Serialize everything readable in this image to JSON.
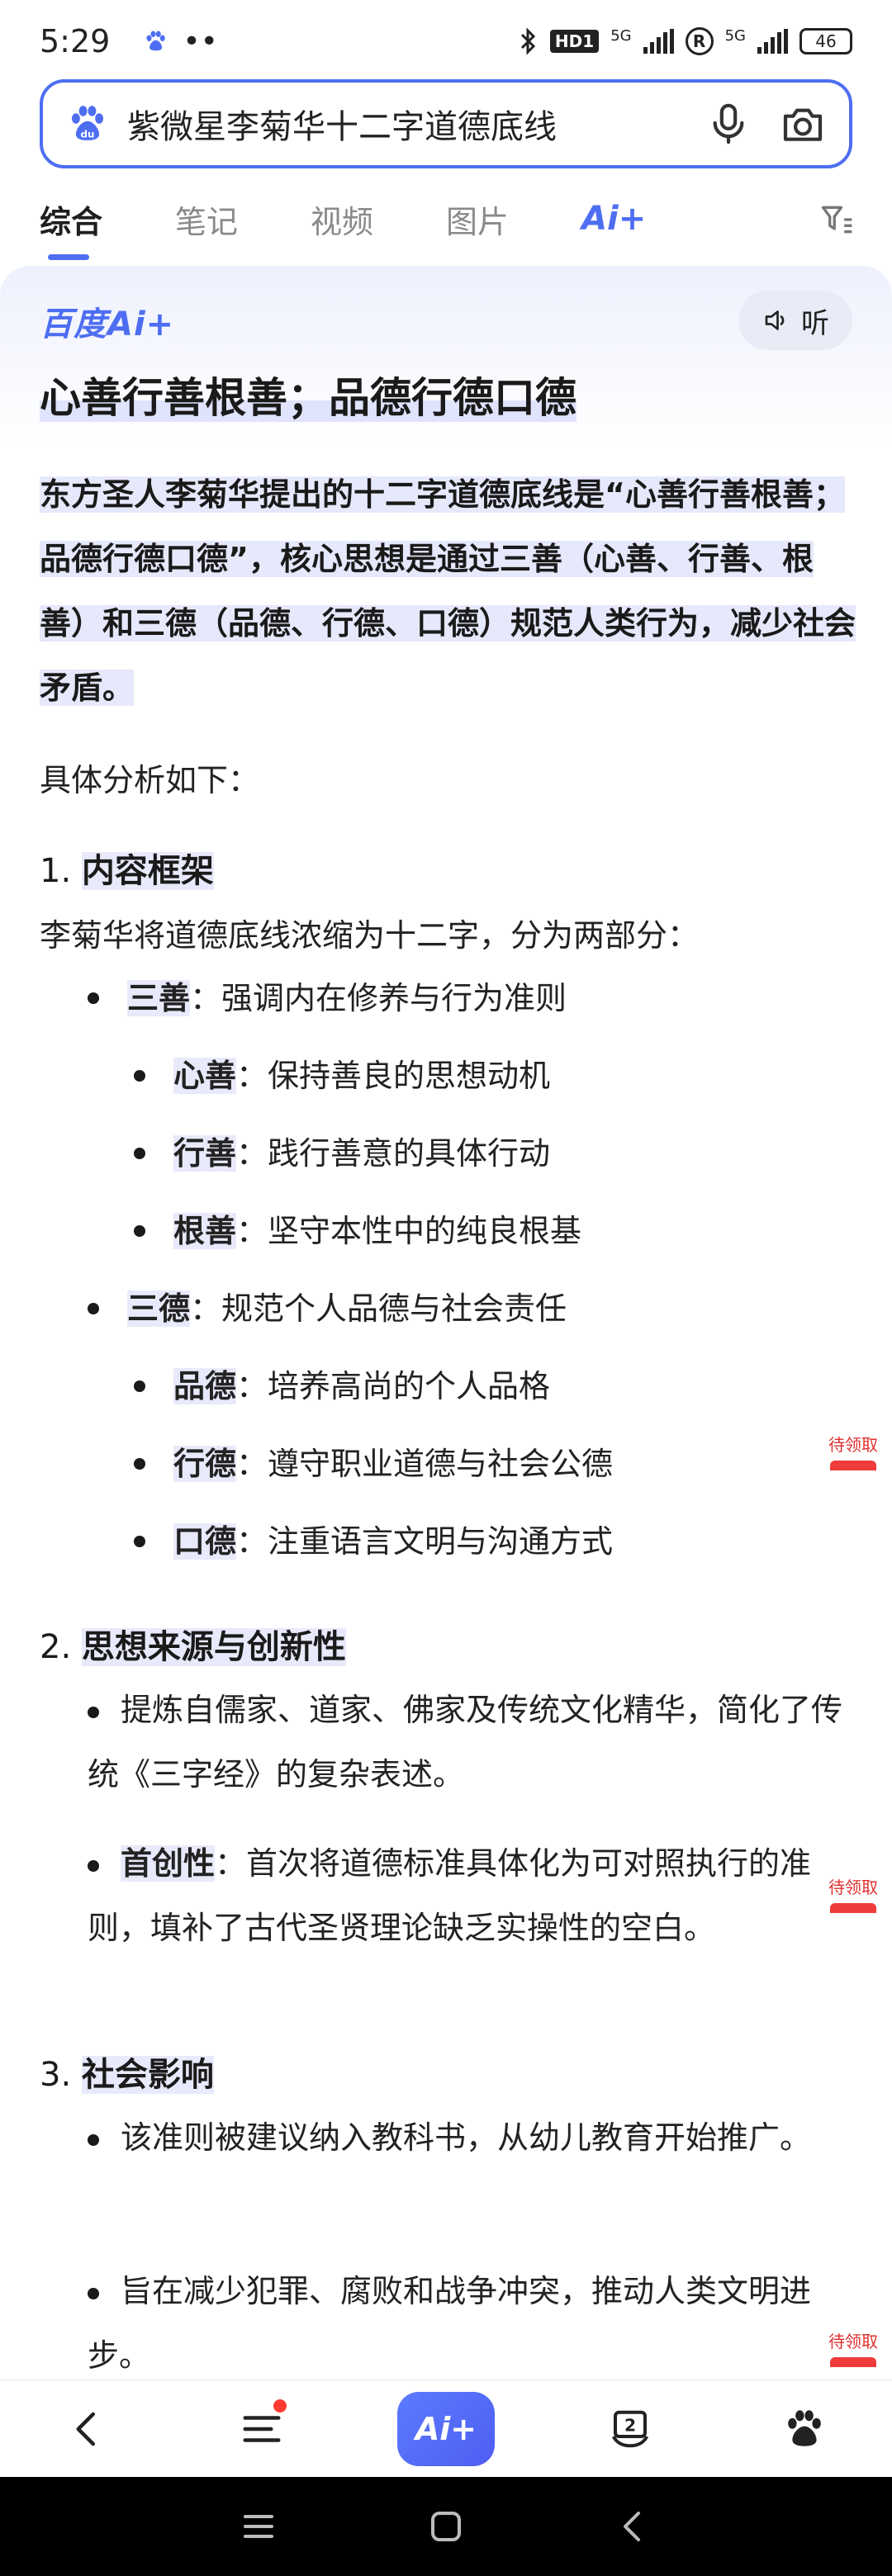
{
  "status_bar": {
    "time": "5:29",
    "dots": "••",
    "hd": "HD1",
    "net1": "5G",
    "r": "R",
    "net2": "5G",
    "battery": "46"
  },
  "search": {
    "query": "紫微星李菊华十二字道德底线"
  },
  "tabs": [
    {
      "label": "综合"
    },
    {
      "label": "笔记"
    },
    {
      "label": "视频"
    },
    {
      "label": "图片"
    },
    {
      "label": "Ai+"
    }
  ],
  "card": {
    "brand": "百度Ai+",
    "listen": "听",
    "title": "心善行善根善；品德行德口德",
    "summary": "东方圣人李菊华提出的十二字道德底线是“心善行善根善；品德行德口德”，核心思想是通过三善（心善、行善、根善）和三德（品德、行德、口德）规范人类行为，减少社会矛盾。",
    "intro": "具体分析如下：",
    "s1": {
      "num": "1. ",
      "title": "内容框架",
      "desc": "李菊华将道德底线浓缩为十二字，分为两部分：",
      "groups": [
        {
          "term": "三善",
          "text": "：强调内在修养与行为准则",
          "items": [
            {
              "term": "心善",
              "text": "：保持善良的思想动机"
            },
            {
              "term": "行善",
              "text": "：践行善意的具体行动"
            },
            {
              "term": "根善",
              "text": "：坚守本性中的纯良根基"
            }
          ]
        },
        {
          "term": "三德",
          "text": "：规范个人品德与社会责任",
          "items": [
            {
              "term": "品德",
              "text": "：培养高尚的个人品格"
            },
            {
              "term": "行德",
              "text": "：遵守职业道德与社会公德"
            },
            {
              "term": "口德",
              "text": "：注重语言文明与沟通方式"
            }
          ]
        }
      ]
    },
    "s2": {
      "num": "2. ",
      "title": "思想来源与创新性",
      "p1": "提炼自儒家、道家、佛家及传统文化精华，简化了传统《三字经》的复杂表述。",
      "p2_term": "首创性",
      "p2_text": "：首次将道德标准具体化为可对照执行的准则，填补了古代圣贤理论缺乏实操性的空白。"
    },
    "s3": {
      "num": "3. ",
      "title": "社会影响",
      "p1": "该准则被建议纳入教科书，从幼儿教育开始推广。",
      "p2": "旨在减少犯罪、腐败和战争冲突，推动人类文明进步。"
    },
    "promo_label": "待领取"
  },
  "bottom_nav": {
    "ai": "Ai+",
    "tabs_count": "2"
  }
}
